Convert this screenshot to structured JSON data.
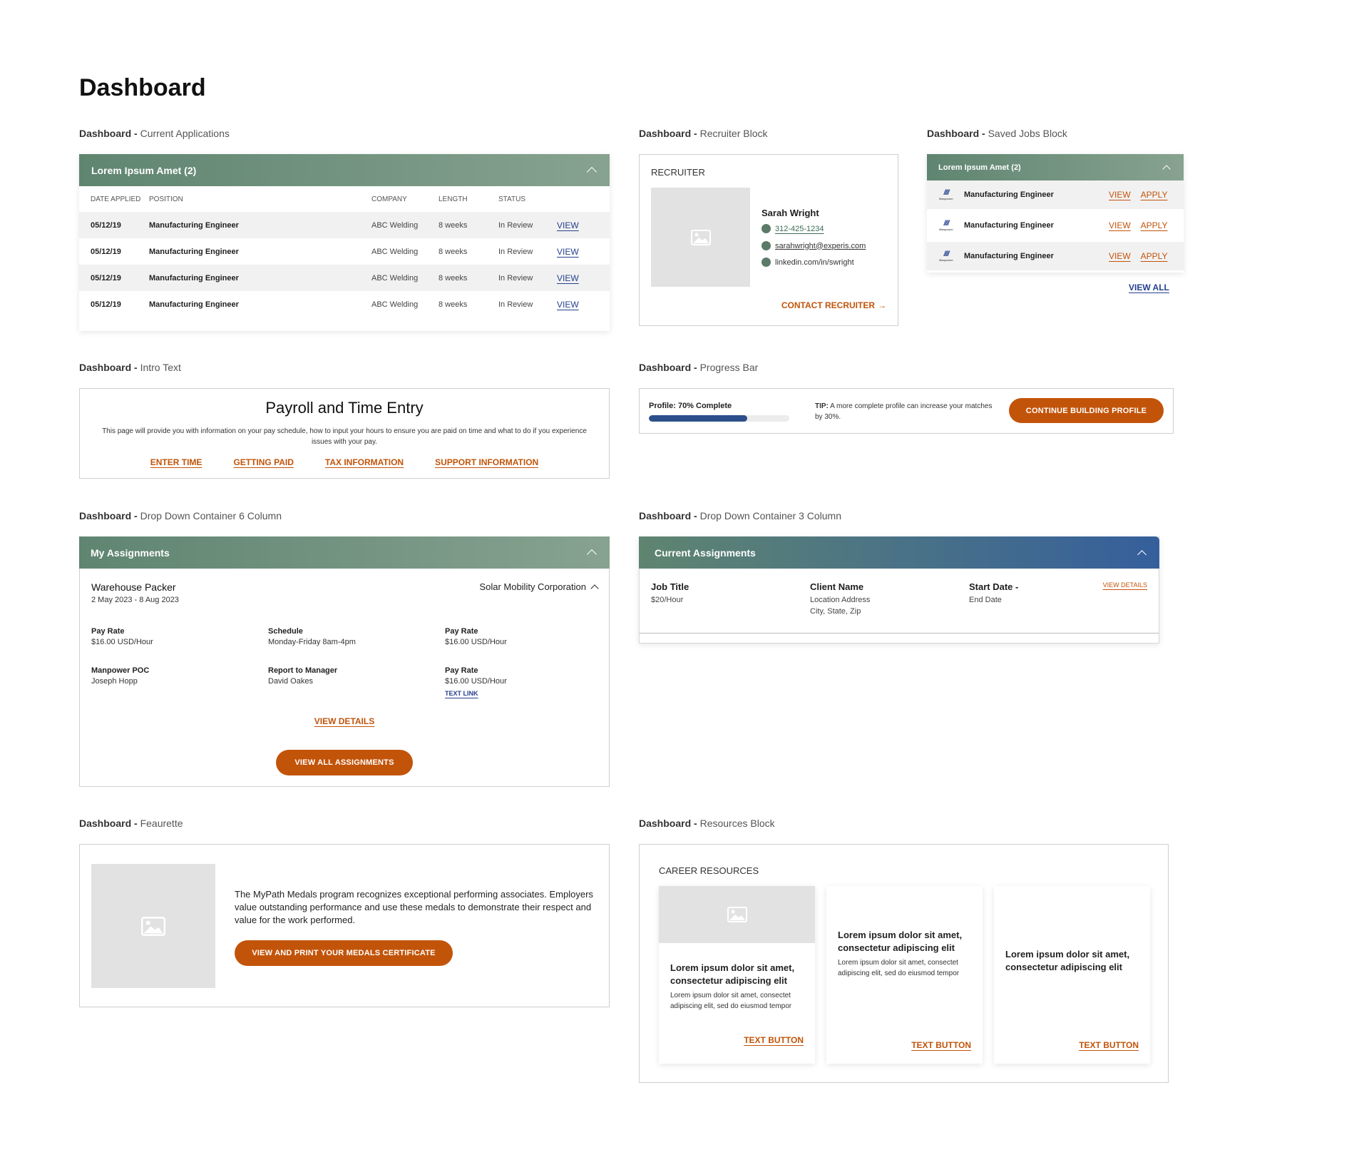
{
  "page": {
    "title": "Dashboard"
  },
  "labels": {
    "current_applications": {
      "prefix": "Dashboard - ",
      "name": "Current Applications"
    },
    "recruiter_block": {
      "prefix": "Dashboard - ",
      "name": "Recruiter Block"
    },
    "saved_jobs_block": {
      "prefix": "Dashboard - ",
      "name": "Saved Jobs Block"
    },
    "intro_text": {
      "prefix": "Dashboard - ",
      "name": "Intro Text"
    },
    "progress_bar": {
      "prefix": "Dashboard - ",
      "name": "Progress Bar"
    },
    "dropdown_6col": {
      "prefix": "Dashboard - ",
      "name": "Drop Down Container 6 Column"
    },
    "dropdown_3col": {
      "prefix": "Dashboard - ",
      "name": "Drop Down Container 3 Column"
    },
    "feaurette": {
      "prefix": "Dashboard - ",
      "name": "Feaurette"
    },
    "resources_block": {
      "prefix": "Dashboard - ",
      "name": "Resources Block"
    }
  },
  "current_applications": {
    "header": "Lorem Ipsum Amet (2)",
    "columns": [
      "DATE APPLIED",
      "POSITION",
      "COMPANY",
      "LENGTH",
      "STATUS"
    ],
    "rows": [
      {
        "date": "05/12/19",
        "position": "Manufacturing Engineer",
        "company": "ABC Welding",
        "length": "8 weeks",
        "status": "In Review",
        "action": "VIEW"
      },
      {
        "date": "05/12/19",
        "position": "Manufacturing Engineer",
        "company": "ABC Welding",
        "length": "8 weeks",
        "status": "In Review",
        "action": "VIEW"
      },
      {
        "date": "05/12/19",
        "position": "Manufacturing Engineer",
        "company": "ABC Welding",
        "length": "8 weeks",
        "status": "In Review",
        "action": "VIEW"
      },
      {
        "date": "05/12/19",
        "position": "Manufacturing Engineer",
        "company": "ABC Welding",
        "length": "8 weeks",
        "status": "In Review",
        "action": "VIEW"
      }
    ]
  },
  "recruiter": {
    "heading": "RECRUITER",
    "name": "Sarah Wright",
    "phone": "312-425-1234",
    "email": "sarahwright@experis.com",
    "linkedin": "linkedin.com/in/swright",
    "contact_label": "CONTACT RECRUITER",
    "contact_arrow": "→"
  },
  "saved_jobs": {
    "header": "Lorem Ipsum Amet (2)",
    "logo_text": "Manpower",
    "items": [
      {
        "title": "Manufacturing Engineer",
        "view": "VIEW",
        "apply": "APPLY"
      },
      {
        "title": "Manufacturing Engineer",
        "view": "VIEW",
        "apply": "APPLY"
      },
      {
        "title": "Manufacturing Engineer",
        "view": "VIEW",
        "apply": "APPLY"
      }
    ],
    "view_all": "VIEW ALL"
  },
  "intro": {
    "title": "Payroll and Time Entry",
    "body": "This page will provide you with information on your pay schedule, how to input your hours to ensure you are paid on time and what to do if you experience issues with your pay.",
    "links": [
      "ENTER TIME",
      "GETTING PAID",
      "TAX INFORMATION",
      "SUPPORT INFORMATION"
    ]
  },
  "progress": {
    "label": "Profile: 70% Complete",
    "percent": 70,
    "tip_bold": "TIP:",
    "tip_text": "A more complete profile can increase your matches by 30%.",
    "button": "CONTINUE BUILDING PROFILE",
    "fill_color": "#2c4f8a"
  },
  "my_assignments": {
    "header": "My Assignments",
    "job_title": "Warehouse Packer",
    "dates": "2 May 2023 - 8 Aug 2023",
    "company": "Solar Mobility Corporation",
    "fields": [
      {
        "label": "Pay Rate",
        "value": "$16.00 USD/Hour"
      },
      {
        "label": "Schedule",
        "value": "Monday-Friday 8am-4pm"
      },
      {
        "label": "Pay Rate",
        "value": "$16.00 USD/Hour"
      },
      {
        "label": "Manpower POC",
        "value": "Joseph Hopp"
      },
      {
        "label": "Report to Manager",
        "value": "David Oakes"
      },
      {
        "label": "Pay Rate",
        "value": "$16.00 USD/Hour"
      }
    ],
    "text_link": "TEXT LINK",
    "view_details": "VIEW DETAILS",
    "view_all": "VIEW ALL ASSIGNMENTS"
  },
  "current_assignments": {
    "header": "Current Assignments",
    "col1_title": "Job Title",
    "col1_sub": "$20/Hour",
    "col2_title": "Client Name",
    "col2_sub1": "Location Address",
    "col2_sub2": "City, State, Zip",
    "col3_title": "Start Date -",
    "col3_sub": "End Date",
    "view_details": "VIEW DETAILS"
  },
  "feaurette": {
    "body": "The MyPath Medals program recognizes exceptional performing associates. Employers value outstanding performance and use these medals to demonstrate their respect and value for the work performed.",
    "button": "VIEW AND PRINT YOUR MEDALS CERTIFICATE"
  },
  "resources": {
    "heading": "CAREER RESOURCES",
    "cards": [
      {
        "title": "Lorem ipsum dolor sit amet, consectetur adipiscing elit",
        "body": "Lorem ipsum dolor sit amet, consectet adipiscing elit, sed do eiusmod tempor",
        "button": "TEXT BUTTON"
      },
      {
        "title": "Lorem ipsum dolor sit amet, consectetur adipiscing elit",
        "body": "Lorem ipsum dolor sit amet, consectet adipiscing elit, sed do eiusmod tempor",
        "button": "TEXT BUTTON"
      },
      {
        "title": "Lorem ipsum dolor sit amet, consectetur adipiscing elit",
        "button": "TEXT BUTTON"
      }
    ]
  },
  "colors": {
    "header_green_start": "#5f8570",
    "header_green_end": "#87a290",
    "header_blue_end": "#355f9c",
    "accent_orange": "#c2540a",
    "link_blue": "#25408f"
  },
  "icons": [
    "image-placeholder-icon",
    "phone-icon",
    "email-icon",
    "linkedin-icon",
    "chevron-up-icon",
    "arrow-right-icon",
    "manpower-logo"
  ]
}
